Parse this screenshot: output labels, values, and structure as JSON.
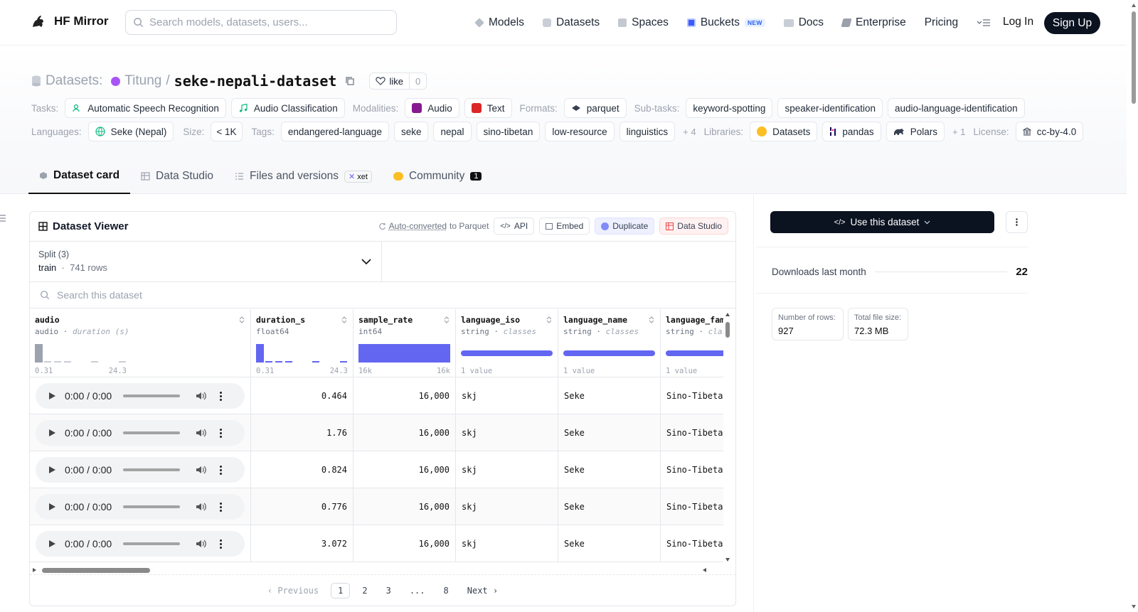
{
  "nav": {
    "brand": "HF Mirror",
    "search_placeholder": "Search models, datasets, users...",
    "links": [
      {
        "label": "Models",
        "icon": "models-icon"
      },
      {
        "label": "Datasets",
        "icon": "datasets-icon"
      },
      {
        "label": "Spaces",
        "icon": "spaces-icon"
      },
      {
        "label": "Buckets",
        "icon": "buckets-icon",
        "badge": "NEW"
      },
      {
        "label": "Docs",
        "icon": "docs-icon"
      },
      {
        "label": "Enterprise",
        "icon": "enterprise-icon"
      },
      {
        "label": "Pricing"
      }
    ],
    "login": "Log In",
    "signup": "Sign Up"
  },
  "header": {
    "prefix": "Datasets:",
    "owner": "Titung",
    "separator": "/",
    "name": "seke-nepali-dataset",
    "like_label": "like",
    "like_count": "0",
    "tasks_label": "Tasks:",
    "tasks": [
      "Automatic Speech Recognition",
      "Audio Classification"
    ],
    "modalities_label": "Modalities:",
    "modalities": [
      "Audio",
      "Text"
    ],
    "formats_label": "Formats:",
    "formats": [
      "parquet"
    ],
    "subtasks_label": "Sub-tasks:",
    "subtasks": [
      "keyword-spotting",
      "speaker-identification",
      "audio-language-identification"
    ],
    "languages_label": "Languages:",
    "languages": [
      "Seke (Nepal)"
    ],
    "size_label": "Size:",
    "size": "< 1K",
    "tags_label": "Tags:",
    "tags": [
      "endangered-language",
      "seke",
      "nepal",
      "sino-tibetan",
      "low-resource",
      "linguistics"
    ],
    "tags_more": "+ 4",
    "libraries_label": "Libraries:",
    "libraries": [
      "Datasets",
      "pandas",
      "Polars"
    ],
    "libraries_more": "+ 1",
    "license_label": "License:",
    "license": "cc-by-4.0"
  },
  "tabs": [
    {
      "label": "Dataset card",
      "active": true
    },
    {
      "label": "Data Studio"
    },
    {
      "label": "Files and versions",
      "badge": "xet"
    },
    {
      "label": "Community",
      "badge": "1"
    }
  ],
  "viewer": {
    "title": "Dataset Viewer",
    "auto_converted": "Auto-converted",
    "to_parquet": "to Parquet",
    "api": "API",
    "embed": "Embed",
    "duplicate": "Duplicate",
    "data_studio": "Data Studio",
    "split_label": "Split (3)",
    "split_name": "train",
    "split_rows": "741 rows",
    "search_placeholder": "Search this dataset",
    "columns": [
      {
        "name": "audio",
        "type": "audio",
        "sub": "duration (s)",
        "min": "0.31",
        "max": "24.3"
      },
      {
        "name": "duration_s",
        "type": "float64",
        "sub": "",
        "min": "0.31",
        "max": "24.3"
      },
      {
        "name": "sample_rate",
        "type": "int64",
        "sub": "",
        "min": "16k",
        "max": "16k"
      },
      {
        "name": "language_iso",
        "type": "string",
        "sub": "classes",
        "min": "1 value",
        "max": ""
      },
      {
        "name": "language_name",
        "type": "string",
        "sub": "classes",
        "min": "1 value",
        "max": ""
      },
      {
        "name": "language_family",
        "type": "string",
        "sub": "classes",
        "min": "1 value",
        "max": ""
      }
    ],
    "rows": [
      {
        "time": "0:00 / 0:00",
        "duration": "0.464",
        "rate": "16,000",
        "iso": "skj",
        "lang": "Seke",
        "family": "Sino-Tibetan"
      },
      {
        "time": "0:00 / 0:00",
        "duration": "1.76",
        "rate": "16,000",
        "iso": "skj",
        "lang": "Seke",
        "family": "Sino-Tibetan"
      },
      {
        "time": "0:00 / 0:00",
        "duration": "0.824",
        "rate": "16,000",
        "iso": "skj",
        "lang": "Seke",
        "family": "Sino-Tibetan"
      },
      {
        "time": "0:00 / 0:00",
        "duration": "0.776",
        "rate": "16,000",
        "iso": "skj",
        "lang": "Seke",
        "family": "Sino-Tibetan"
      },
      {
        "time": "0:00 / 0:00",
        "duration": "3.072",
        "rate": "16,000",
        "iso": "skj",
        "lang": "Seke",
        "family": "Sino-Tibetan"
      }
    ],
    "pager": {
      "previous": "Previous",
      "pages": [
        "1",
        "2",
        "3",
        "...",
        "8"
      ],
      "current": "1",
      "next": "Next"
    }
  },
  "sidebar": {
    "use_button": "Use this dataset",
    "downloads_label": "Downloads last month",
    "downloads_value": "22",
    "rows_label": "Number of rows:",
    "rows_value": "927",
    "size_label": "Total file size:",
    "size_value": "72.3 MB"
  },
  "colors": {
    "accent": "#6366f1",
    "dark": "#0b1220",
    "owner_dot": "#a855f7"
  }
}
